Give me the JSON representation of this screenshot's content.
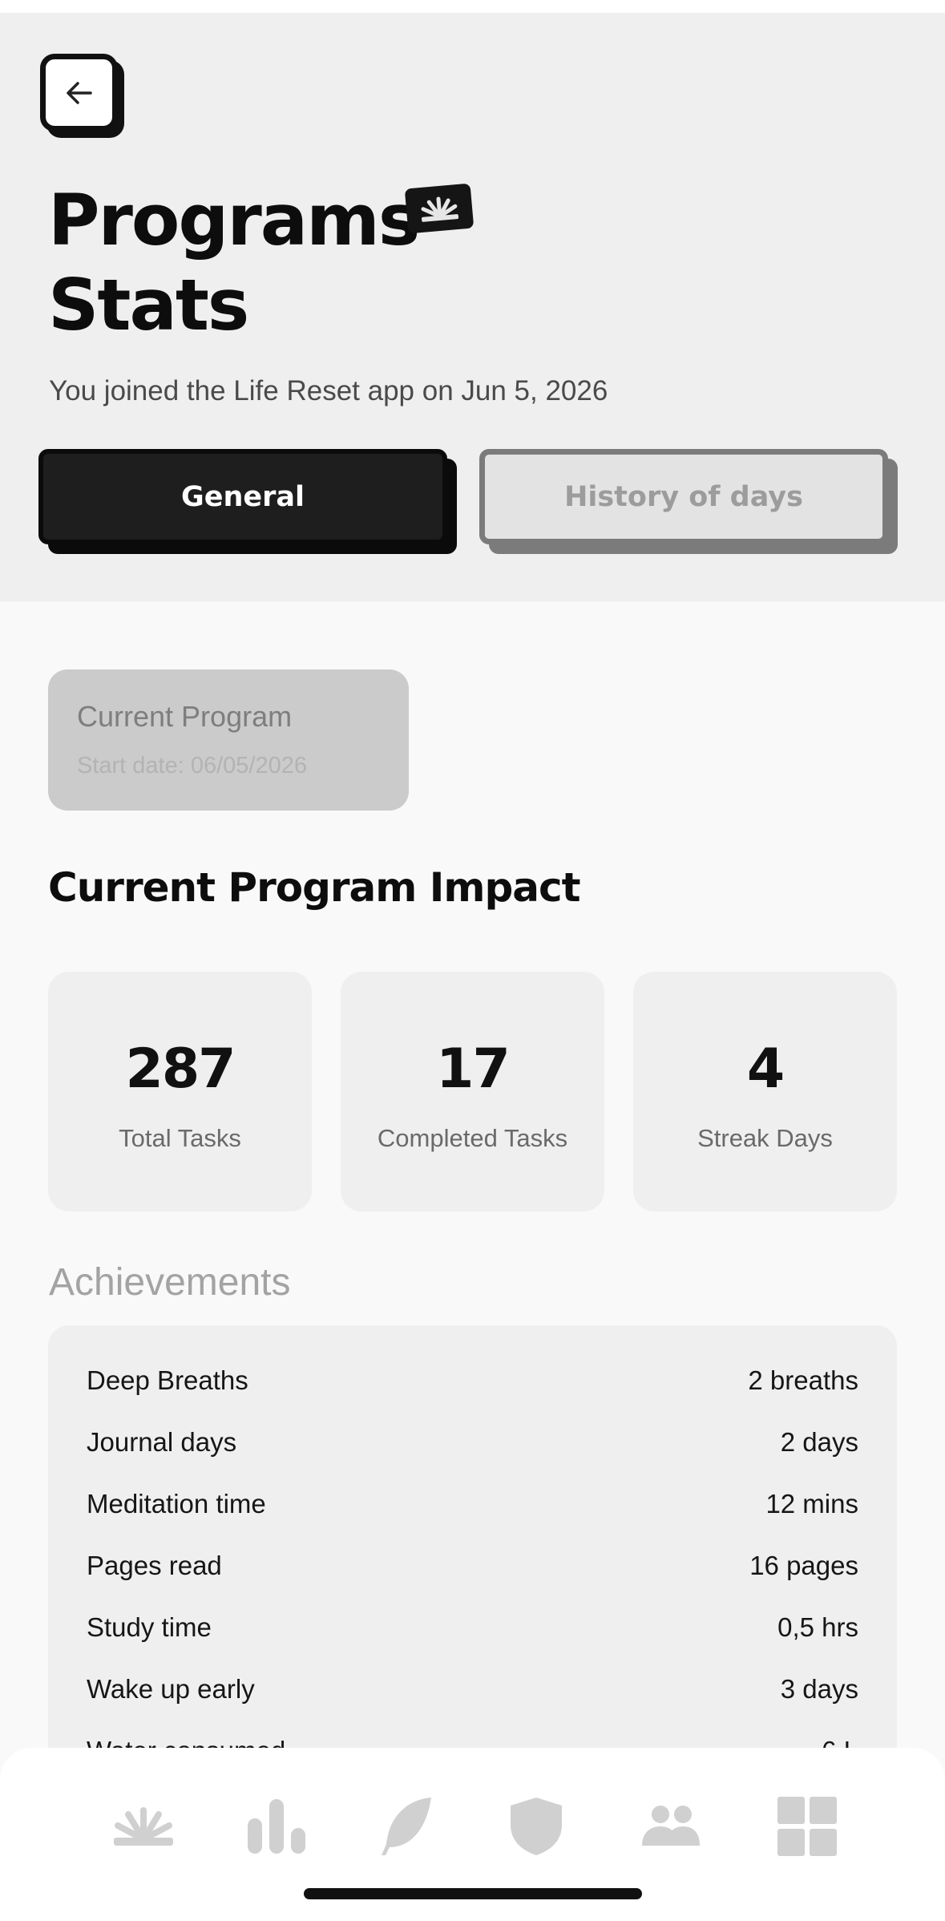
{
  "header": {
    "title_line1": "Programs",
    "title_line2": "Stats",
    "joined_text": "You joined the Life Reset app on Jun 5, 2026"
  },
  "tabs": [
    {
      "label": "General",
      "active": true
    },
    {
      "label": "History of days",
      "active": false
    }
  ],
  "current_program": {
    "name": "Current Program",
    "start_date": "Start date: 06/05/2026"
  },
  "impact": {
    "title": "Current Program Impact",
    "stats": [
      {
        "value": "287",
        "label": "Total Tasks"
      },
      {
        "value": "17",
        "label": "Completed Tasks"
      },
      {
        "value": "4",
        "label": "Streak Days"
      }
    ]
  },
  "achievements": {
    "title": "Achievements",
    "rows": [
      {
        "label": "Deep Breaths",
        "value": "2 breaths"
      },
      {
        "label": "Journal days",
        "value": "2 days"
      },
      {
        "label": "Meditation time",
        "value": "12 mins"
      },
      {
        "label": "Pages read",
        "value": "16 pages"
      },
      {
        "label": "Study time",
        "value": "0,5 hrs"
      },
      {
        "label": "Wake up early",
        "value": "3 days"
      },
      {
        "label": "Water consumed",
        "value": "6 L"
      }
    ]
  },
  "bottom_nav": {
    "items": [
      "sunrise-icon",
      "bar-chart-icon",
      "feather-icon",
      "shield-icon",
      "people-icon",
      "grid-icon"
    ]
  },
  "colors": {
    "header_bg": "#efefef",
    "page_bg": "#f9f9f9",
    "dark": "#1e1e1e",
    "muted_text": "#a3a3a3",
    "nav_icon": "#d0d0d0"
  }
}
